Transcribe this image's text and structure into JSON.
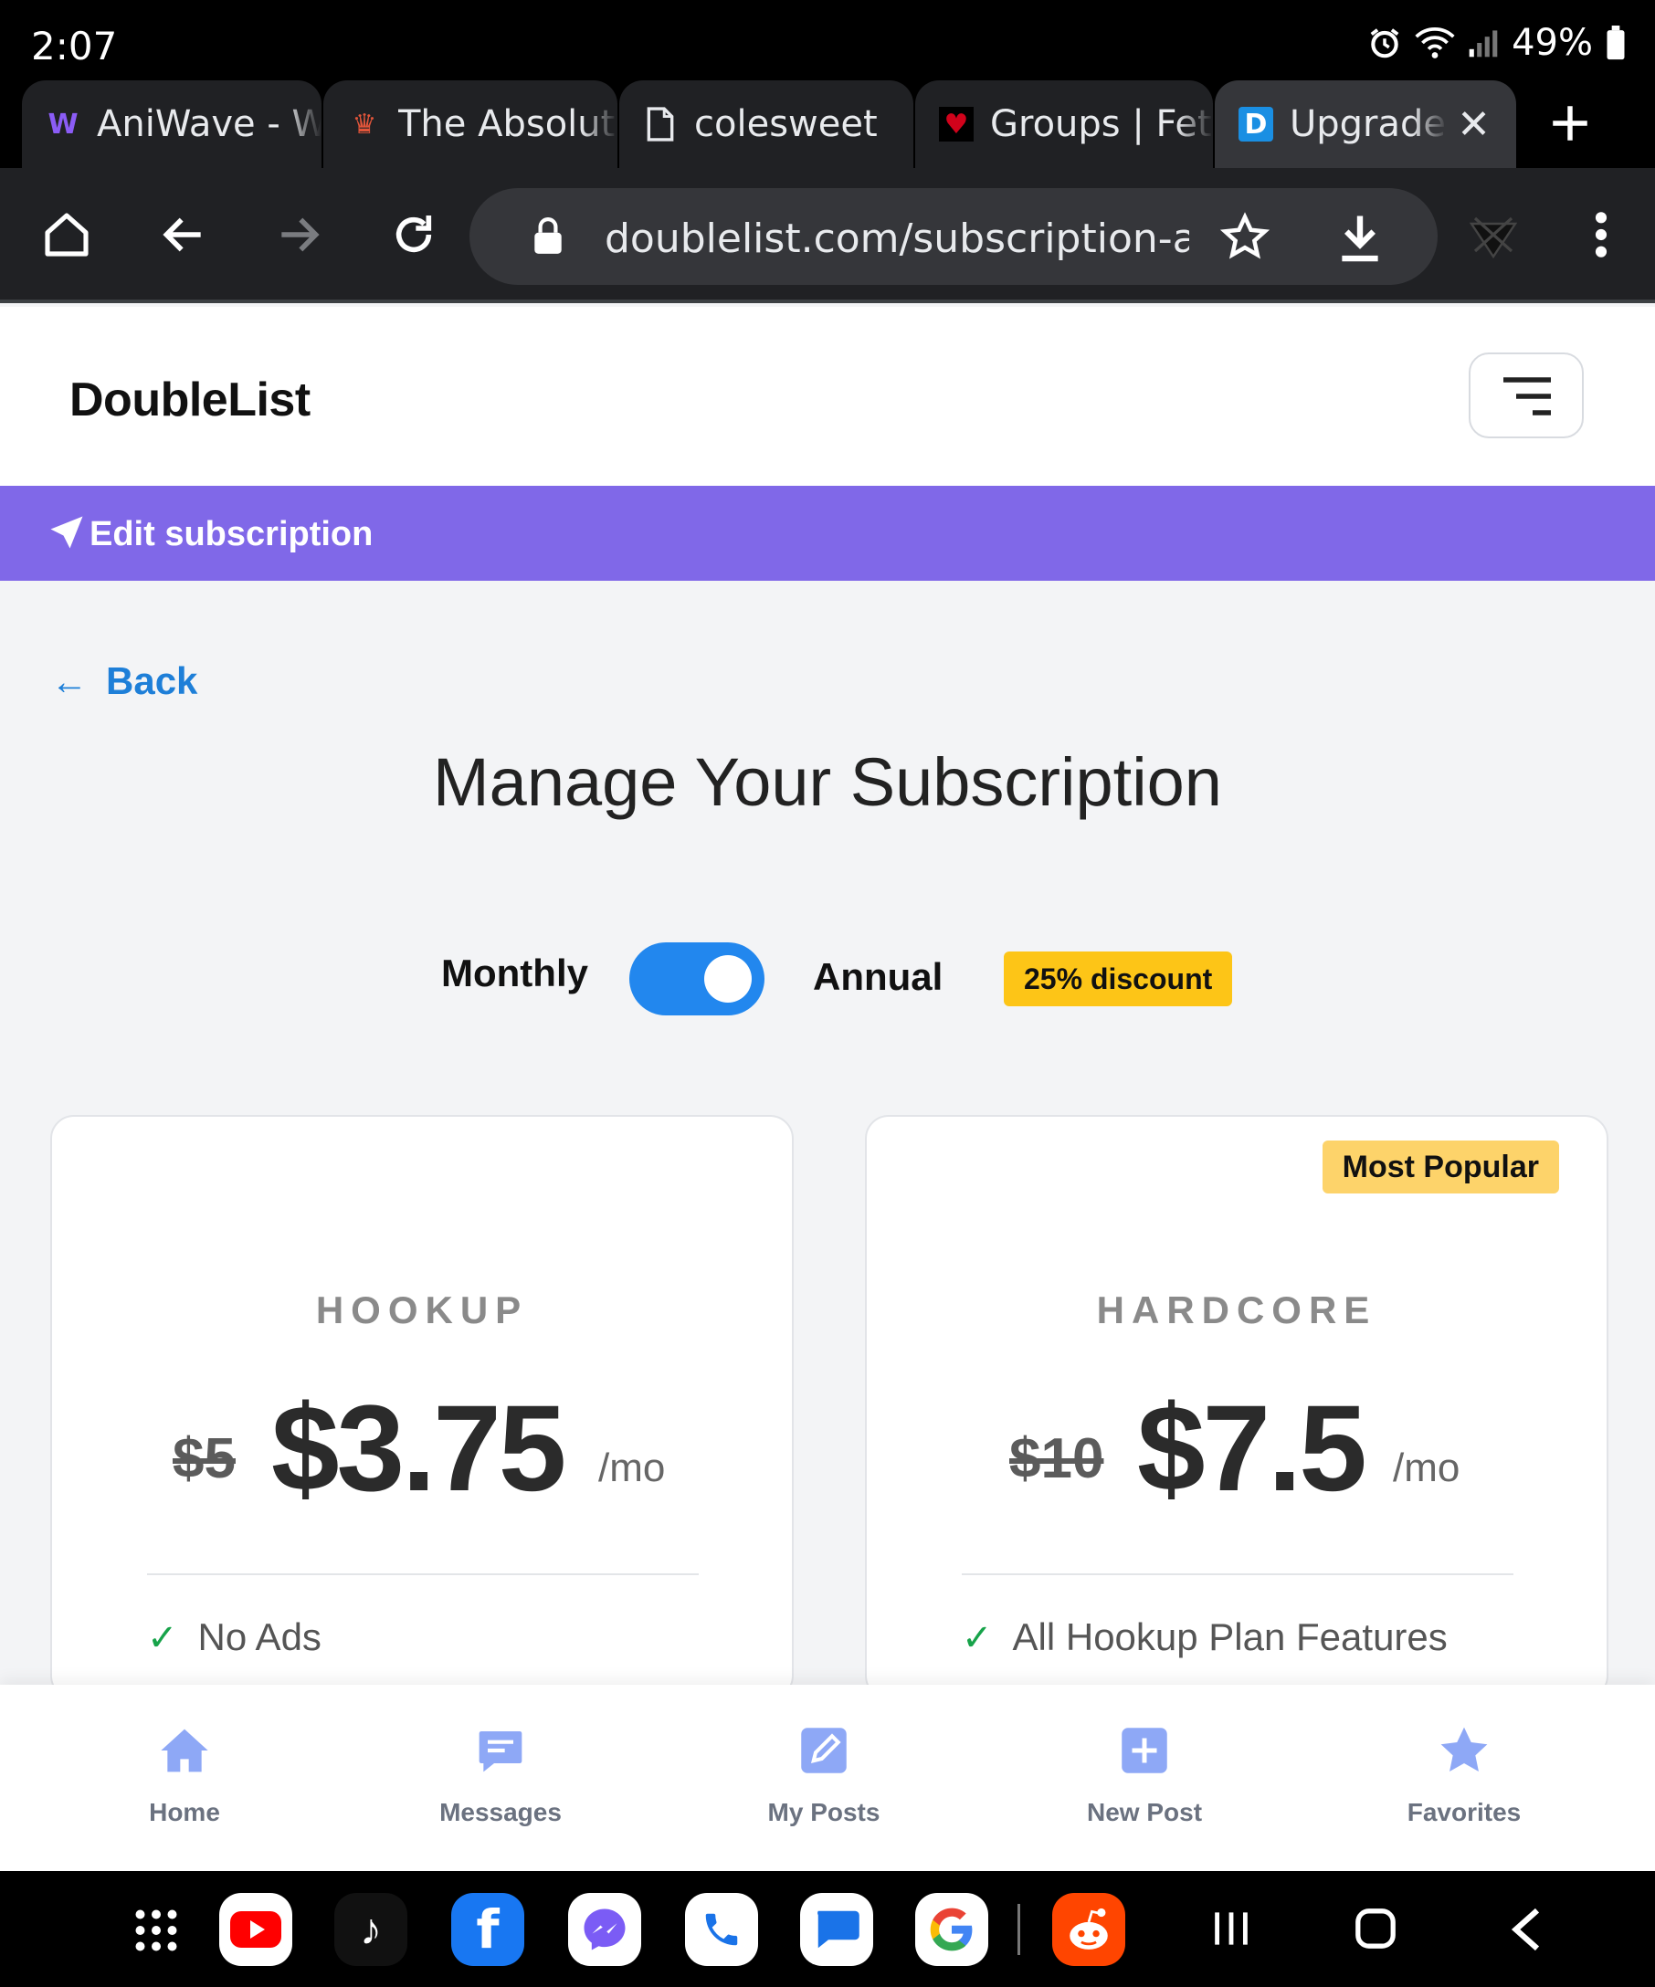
{
  "status_bar": {
    "time": "2:07",
    "battery": "49%"
  },
  "browser": {
    "tabs": [
      {
        "label": "AniWave - W",
        "favicon": "aniwave-favicon",
        "fav_char": "W",
        "fav_color": "#8b5cf6"
      },
      {
        "label": "The Absolute",
        "favicon": "pixel-crown-favicon",
        "fav_char": "♛",
        "fav_color": "#e2553a"
      },
      {
        "label": "colesweet",
        "favicon": "document-icon",
        "fav_char": "",
        "fav_color": "#e8eaed"
      },
      {
        "label": "Groups | FetL",
        "favicon": "fetlife-favicon",
        "fav_char": "♥",
        "fav_color": "#d0021b"
      },
      {
        "label": "Upgrade",
        "favicon": "doublelist-favicon",
        "fav_char": "D",
        "fav_color": "#1a8fe3"
      }
    ],
    "url": "doublelist.com/subscription-an"
  },
  "site": {
    "logo": "DoubleList",
    "banner": "Edit subscription"
  },
  "page": {
    "back_arrow": "←",
    "back_label": "Back",
    "title": "Manage Your Subscription",
    "billing": {
      "monthly_label": "Monthly",
      "annual_label": "Annual",
      "discount_badge": "25% discount",
      "annual_selected": true
    },
    "plans": [
      {
        "name": "HOOKUP",
        "old_price": "$5",
        "price": "$3.75",
        "period": "/mo",
        "features": [
          "No Ads"
        ]
      },
      {
        "name": "HARDCORE",
        "badge": "Most Popular",
        "old_price": "$10",
        "price": "$7.5",
        "period": "/mo",
        "features": [
          "All Hookup Plan Features"
        ]
      }
    ]
  },
  "bottom_nav": [
    {
      "label": "Home",
      "icon": "home-icon"
    },
    {
      "label": "Messages",
      "icon": "messages-icon"
    },
    {
      "label": "My Posts",
      "icon": "edit-icon"
    },
    {
      "label": "New Post",
      "icon": "plus-icon"
    },
    {
      "label": "Favorites",
      "icon": "star-icon"
    }
  ],
  "colors": {
    "accent_purple": "#8068e8",
    "link_blue": "#1e7fd8",
    "toggle_blue": "#2287ee",
    "badge_yellow": "#fdc517",
    "nav_icon": "#8ea8f6"
  }
}
